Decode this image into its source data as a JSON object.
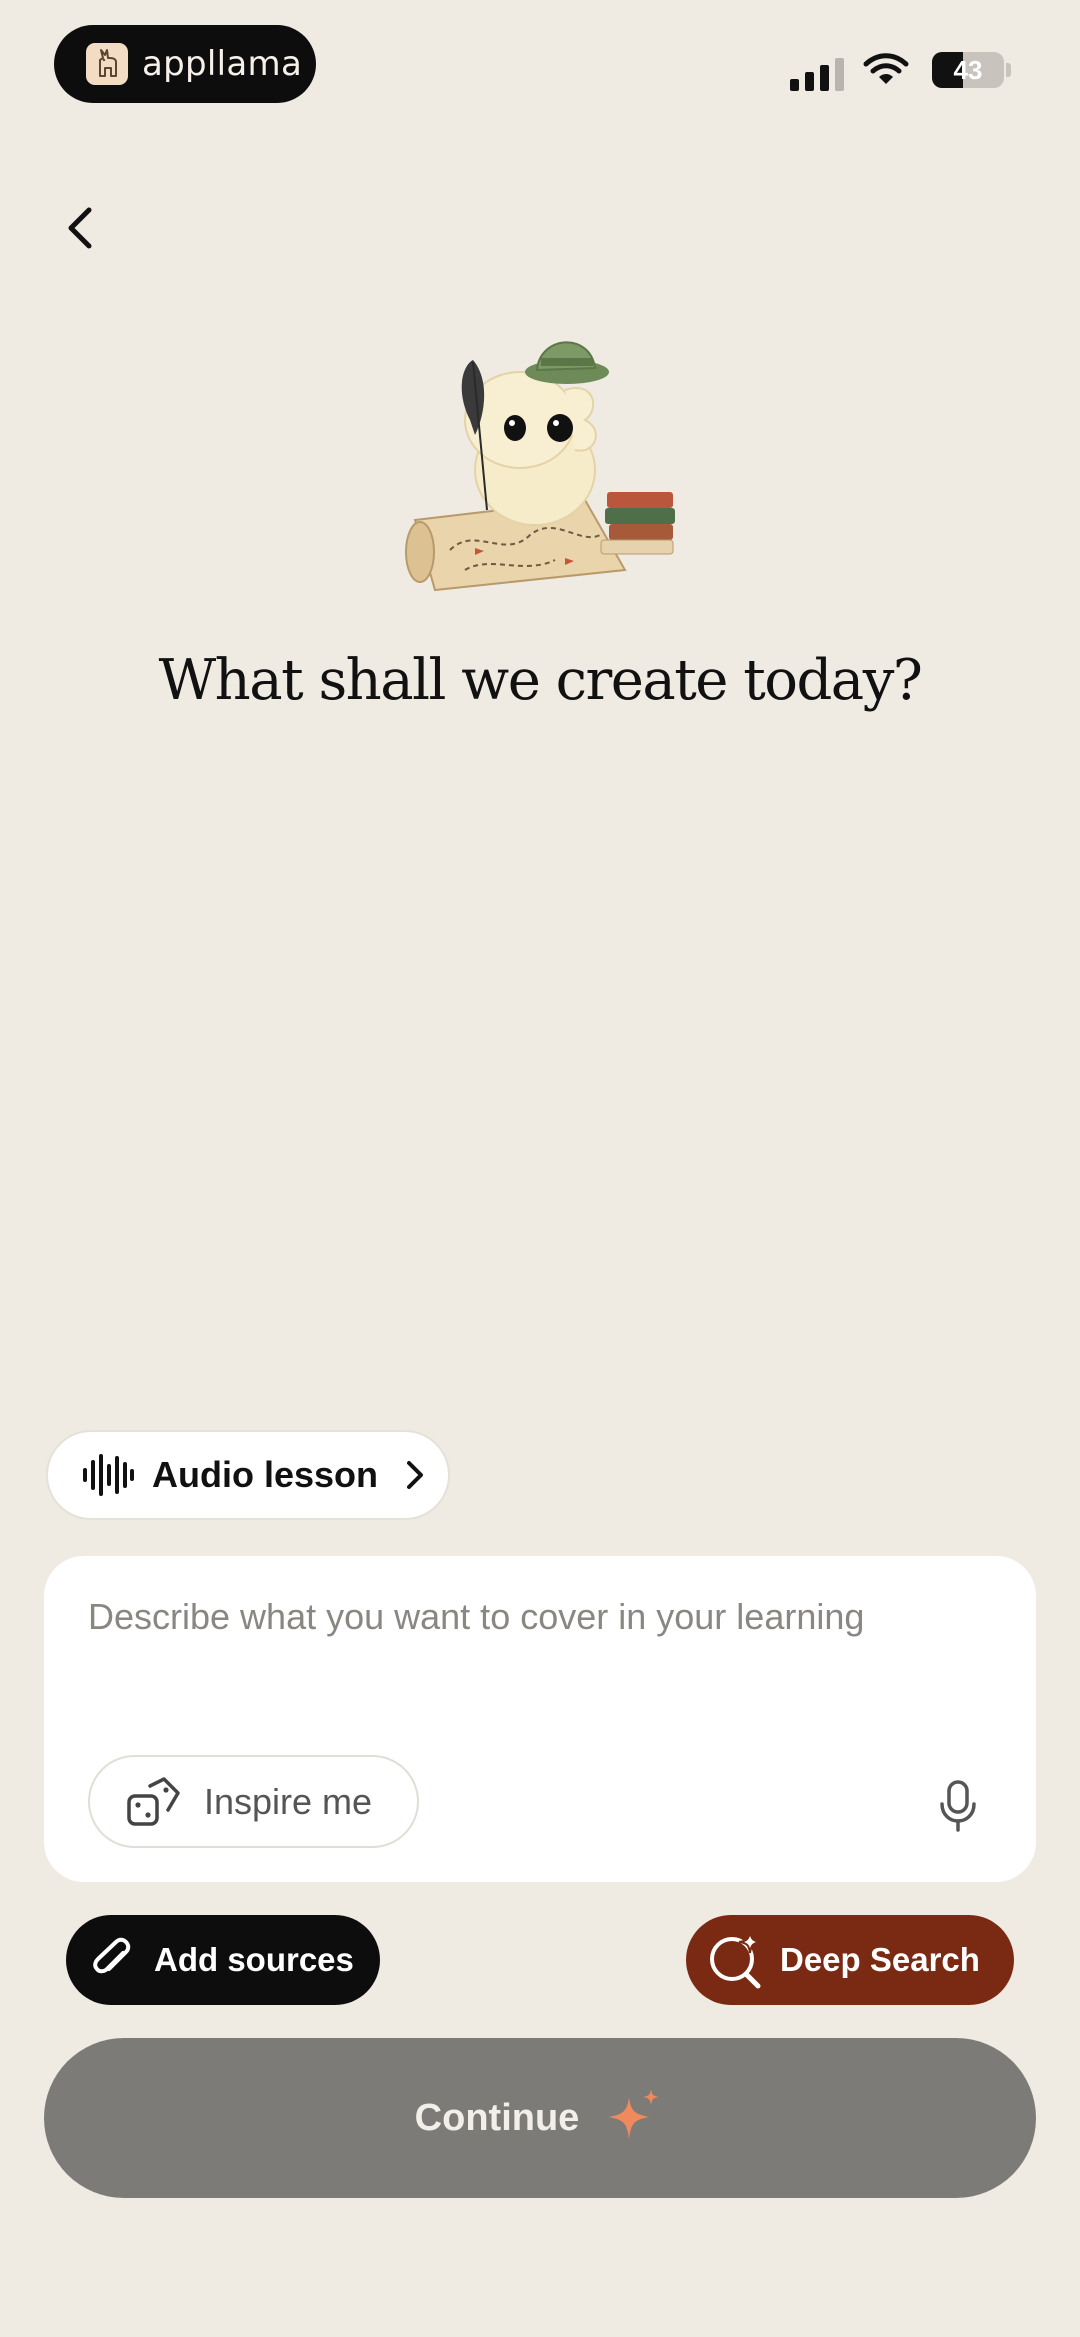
{
  "status_bar": {
    "app_name": "appllama",
    "battery_level": "43"
  },
  "main": {
    "headline": "What shall we create today?"
  },
  "audio_chip": {
    "label": "Audio lesson"
  },
  "prompt": {
    "placeholder": "Describe what you want to cover in your learning",
    "value": "",
    "inspire_label": "Inspire me"
  },
  "actions": {
    "add_sources_label": "Add sources",
    "deep_search_label": "Deep Search",
    "continue_label": "Continue"
  },
  "colors": {
    "background": "#efebe3",
    "deep_search": "#7a2a12",
    "continue_disabled": "#7d7b77",
    "sparkle": "#f08a5d"
  },
  "icons": [
    "llama-logo-icon",
    "signal-icon",
    "wifi-icon",
    "battery-icon",
    "chevron-left-icon",
    "llama-explorer-illustration",
    "audio-waveform-icon",
    "chevron-right-icon",
    "dice-icon",
    "microphone-icon",
    "paperclip-icon",
    "sparkle-search-icon",
    "sparkle-icon"
  ]
}
